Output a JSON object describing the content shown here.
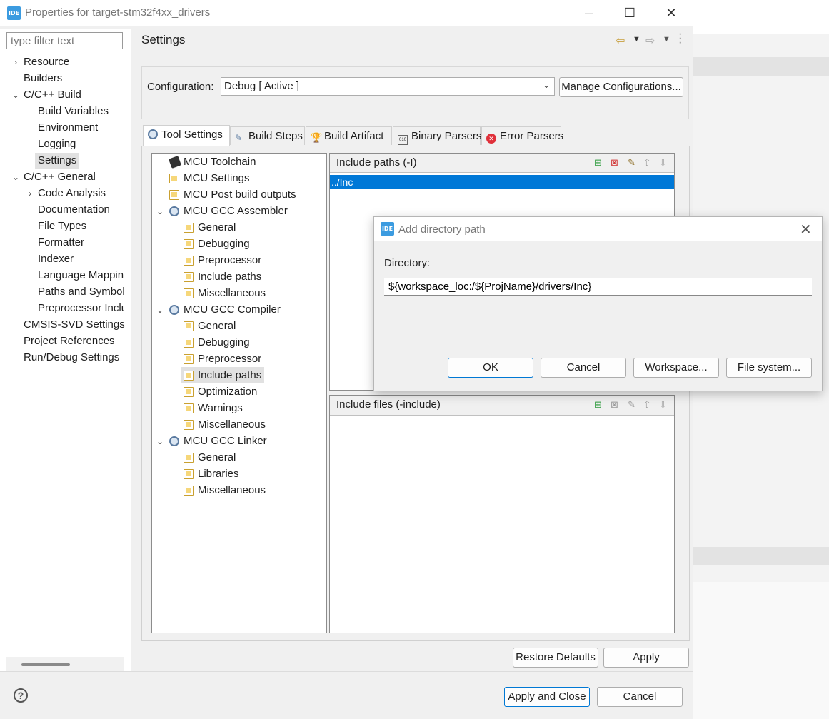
{
  "window": {
    "title": "Properties for target-stm32f4xx_drivers",
    "logo": "IDE",
    "minimize": "—",
    "maximize": "☐",
    "close": "✕"
  },
  "filter": {
    "placeholder": "type filter text"
  },
  "left_tree": {
    "items": [
      {
        "label": "Resource"
      },
      {
        "label": "Builders"
      },
      {
        "label": "C/C++ Build"
      },
      {
        "label": "Build Variables"
      },
      {
        "label": "Environment"
      },
      {
        "label": "Logging"
      },
      {
        "label": "Settings"
      },
      {
        "label": "C/C++ General"
      },
      {
        "label": "Code Analysis"
      },
      {
        "label": "Documentation"
      },
      {
        "label": "File Types"
      },
      {
        "label": "Formatter"
      },
      {
        "label": "Indexer"
      },
      {
        "label": "Language Mappin"
      },
      {
        "label": "Paths and Symbols"
      },
      {
        "label": "Preprocessor Inclu"
      },
      {
        "label": "CMSIS-SVD Settings"
      },
      {
        "label": "Project References"
      },
      {
        "label": "Run/Debug Settings"
      }
    ]
  },
  "settings": {
    "title": "Settings",
    "configuration_label": "Configuration:",
    "configuration_value": "Debug  [ Active ]",
    "manage_button": "Manage Configurations..."
  },
  "tabs": [
    {
      "label": "Tool Settings"
    },
    {
      "label": "Build Steps"
    },
    {
      "label": "Build Artifact"
    },
    {
      "label": "Binary Parsers"
    },
    {
      "label": "Error Parsers"
    }
  ],
  "tool_tree": {
    "items": [
      {
        "label": "MCU Toolchain"
      },
      {
        "label": "MCU Settings"
      },
      {
        "label": "MCU Post build outputs"
      },
      {
        "label": "MCU GCC Assembler"
      },
      {
        "label": "General"
      },
      {
        "label": "Debugging"
      },
      {
        "label": "Preprocessor"
      },
      {
        "label": "Include paths"
      },
      {
        "label": "Miscellaneous"
      },
      {
        "label": "MCU GCC Compiler"
      },
      {
        "label": "General"
      },
      {
        "label": "Debugging"
      },
      {
        "label": "Preprocessor"
      },
      {
        "label": "Include paths"
      },
      {
        "label": "Optimization"
      },
      {
        "label": "Warnings"
      },
      {
        "label": "Miscellaneous"
      },
      {
        "label": "MCU GCC Linker"
      },
      {
        "label": "General"
      },
      {
        "label": "Libraries"
      },
      {
        "label": "Miscellaneous"
      }
    ]
  },
  "include_paths": {
    "title": "Include paths (-I)",
    "rows": [
      "../Inc"
    ]
  },
  "include_files": {
    "title": "Include files (-include)"
  },
  "dialog": {
    "title": "Add directory path",
    "directory_label": "Directory:",
    "directory_value": "${workspace_loc:/${ProjName}/drivers/Inc}",
    "ok": "OK",
    "cancel": "Cancel",
    "workspace": "Workspace...",
    "file_system": "File system..."
  },
  "buttons": {
    "restore_defaults": "Restore Defaults",
    "apply": "Apply",
    "apply_and_close": "Apply and Close",
    "cancel": "Cancel",
    "help": "?"
  },
  "colors": {
    "selection": "#0078d7",
    "accent": "#0078d4",
    "logo": "#3b9be0"
  }
}
